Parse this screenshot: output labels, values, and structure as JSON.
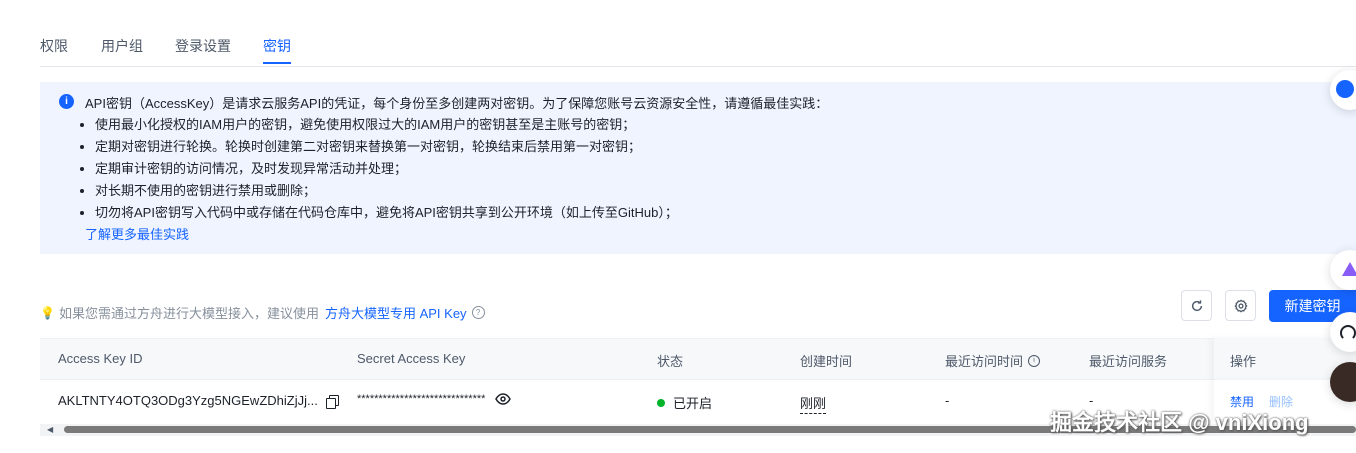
{
  "tabs": [
    "权限",
    "用户组",
    "登录设置",
    "密钥"
  ],
  "active_tab": "密钥",
  "info": {
    "icon": "info-icon",
    "title": "API密钥（AccessKey）是请求云服务API的凭证，每个身份至多创建两对密钥。为了保障您账号云资源安全性，请遵循最佳实践：",
    "items": [
      "使用最小化授权的IAM用户的密钥，避免使用权限过大的IAM用户的密钥甚至是主账号的密钥；",
      "定期对密钥进行轮换。轮换时创建第二对密钥来替换第一对密钥，轮换结束后禁用第一对密钥；",
      "定期审计密钥的访问情况，及时发现异常活动并处理；",
      "对长期不使用的密钥进行禁用或删除；",
      "切勿将API密钥写入代码中或存储在代码仓库中，避免将API密钥共享到公开环境（如上传至GitHub）；"
    ],
    "link": "了解更多最佳实践"
  },
  "hint": {
    "text": "如果您需通过方舟进行大模型接入，建议使用",
    "link": "方舟大模型专用 API Key"
  },
  "toolbar": {
    "refresh_icon": "refresh-icon",
    "settings_icon": "gear-icon",
    "create_label": "新建密钥"
  },
  "table": {
    "columns": [
      "Access Key ID",
      "Secret Access Key",
      "状态",
      "创建时间",
      "最近访问时间",
      "最近访问服务",
      "操作"
    ],
    "rows": [
      {
        "access_key_id": "AKLTNTY4OTQ3ODg3Yzg5NGEwZDhiZjJj...",
        "secret": "******************************",
        "status": "已开启",
        "status_color": "#00b42a",
        "created": "刚刚",
        "last_access": "-",
        "last_service": "-",
        "actions": [
          "禁用",
          "删除"
        ]
      }
    ]
  },
  "watermark": "掘金技术社区 @ vniXiong",
  "colors": {
    "accent": "#1664ff",
    "info_bg": "#eff4ff"
  }
}
